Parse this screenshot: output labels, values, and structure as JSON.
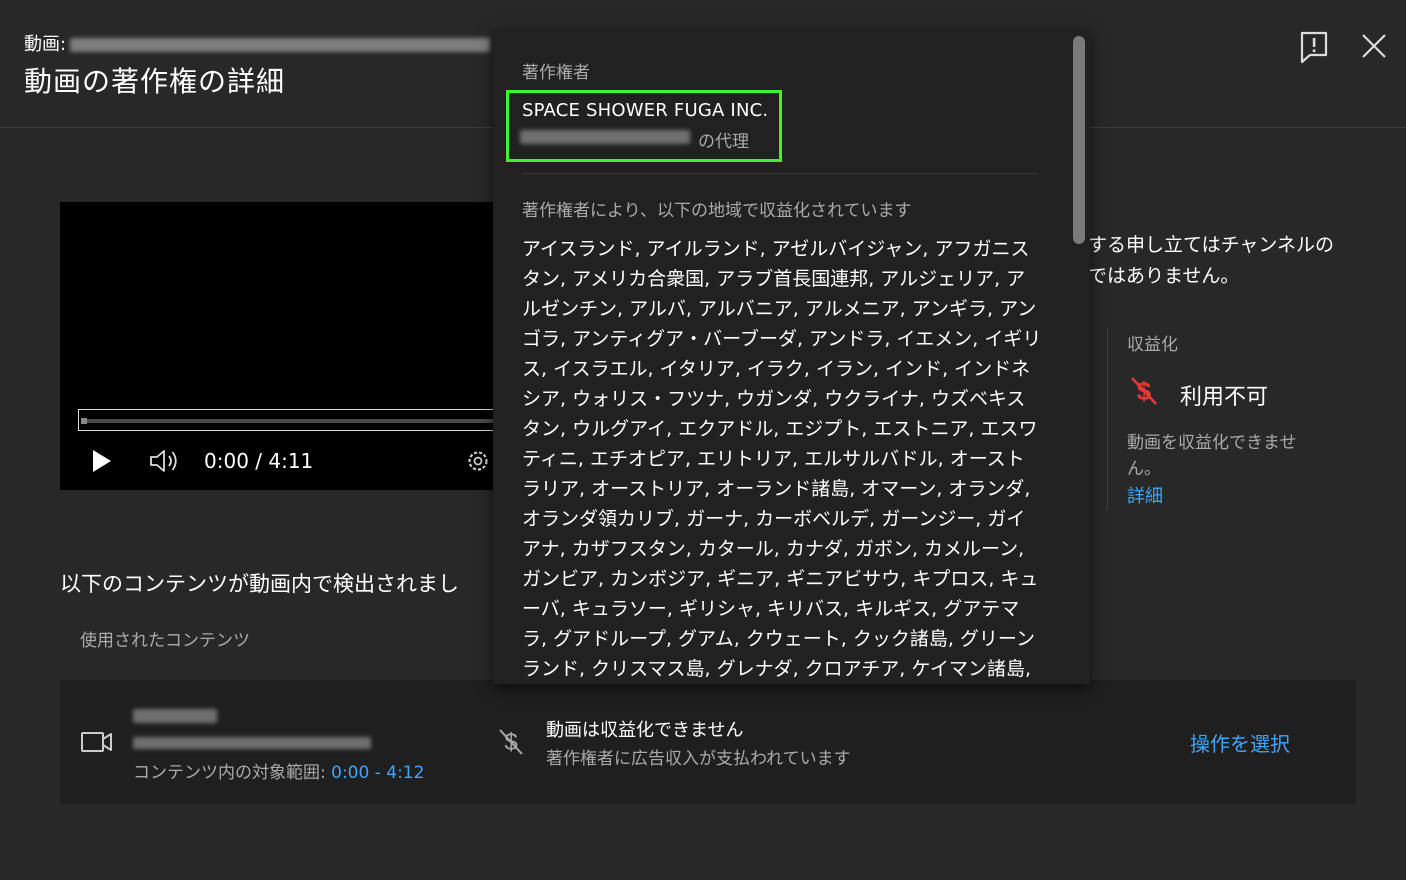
{
  "header": {
    "video_label": "動画:",
    "title": "動画の著作権の詳細",
    "feedback_icon": "feedback-icon",
    "close_icon": "close-icon"
  },
  "player": {
    "time": "0:00 / 4:11",
    "progress": 0
  },
  "info_panel": {
    "claim_text_line1": "する申し立てはチャンネルの",
    "claim_text_line2": "ではありません。",
    "monetization_heading": "収益化",
    "monetization_value": "利用不可",
    "monetization_desc": "動画を収益化できません。",
    "monetization_link": "詳細"
  },
  "detected": {
    "heading": "以下のコンテンツが動画内で検出されまし",
    "used_content_label": "使用されたコンテンツ",
    "range_label": "コンテンツ内の対象範囲: ",
    "range_value": "0:00 - 4:12",
    "status": "動画は収益化できません",
    "status_sub": "著作権者に広告収入が支払われています",
    "action": "操作を選択"
  },
  "popup": {
    "owner_label": "著作権者",
    "owner_name": "SPACE SHOWER FUGA INC.",
    "owner_agent": "の代理",
    "regions_label": "著作権者により、以下の地域で収益化されています",
    "regions_text": "アイスランド, アイルランド, アゼルバイジャン, アフガニスタン, アメリカ合衆国, アラブ首長国連邦, アルジェリア, アルゼンチン, アルバ, アルバニア, アルメニア, アンギラ, アンゴラ, アンティグア・バーブーダ, アンドラ, イエメン, イギリス, イスラエル, イタリア, イラク, イラン, インド, インドネシア, ウォリス・フツナ, ウガンダ, ウクライナ, ウズベキスタン, ウルグアイ, エクアドル, エジプト, エストニア, エスワティニ, エチオピア, エリトリア, エルサルバドル, オーストラリア, オーストリア, オーランド諸島, オマーン, オランダ, オランダ領カリブ, ガーナ, カーボベルデ, ガーンジー, ガイアナ, カザフスタン, カタール, カナダ, ガボン, カメルーン, ガンビア, カンボジア, ギニア, ギニアビサウ, キプロス, キューバ, キュラソー, ギリシャ, キリバス, キルギス, グアテマラ, グアドループ, グアム, クウェート, クック諸島, グリーンランド, クリスマス島, グレナダ, クロアチア, ケイマン諸島, ケニ"
  },
  "colors": {
    "background": "#282828",
    "link": "#3ea6ff",
    "highlight": "#3ef52a",
    "monetization_off": "#e53935"
  }
}
